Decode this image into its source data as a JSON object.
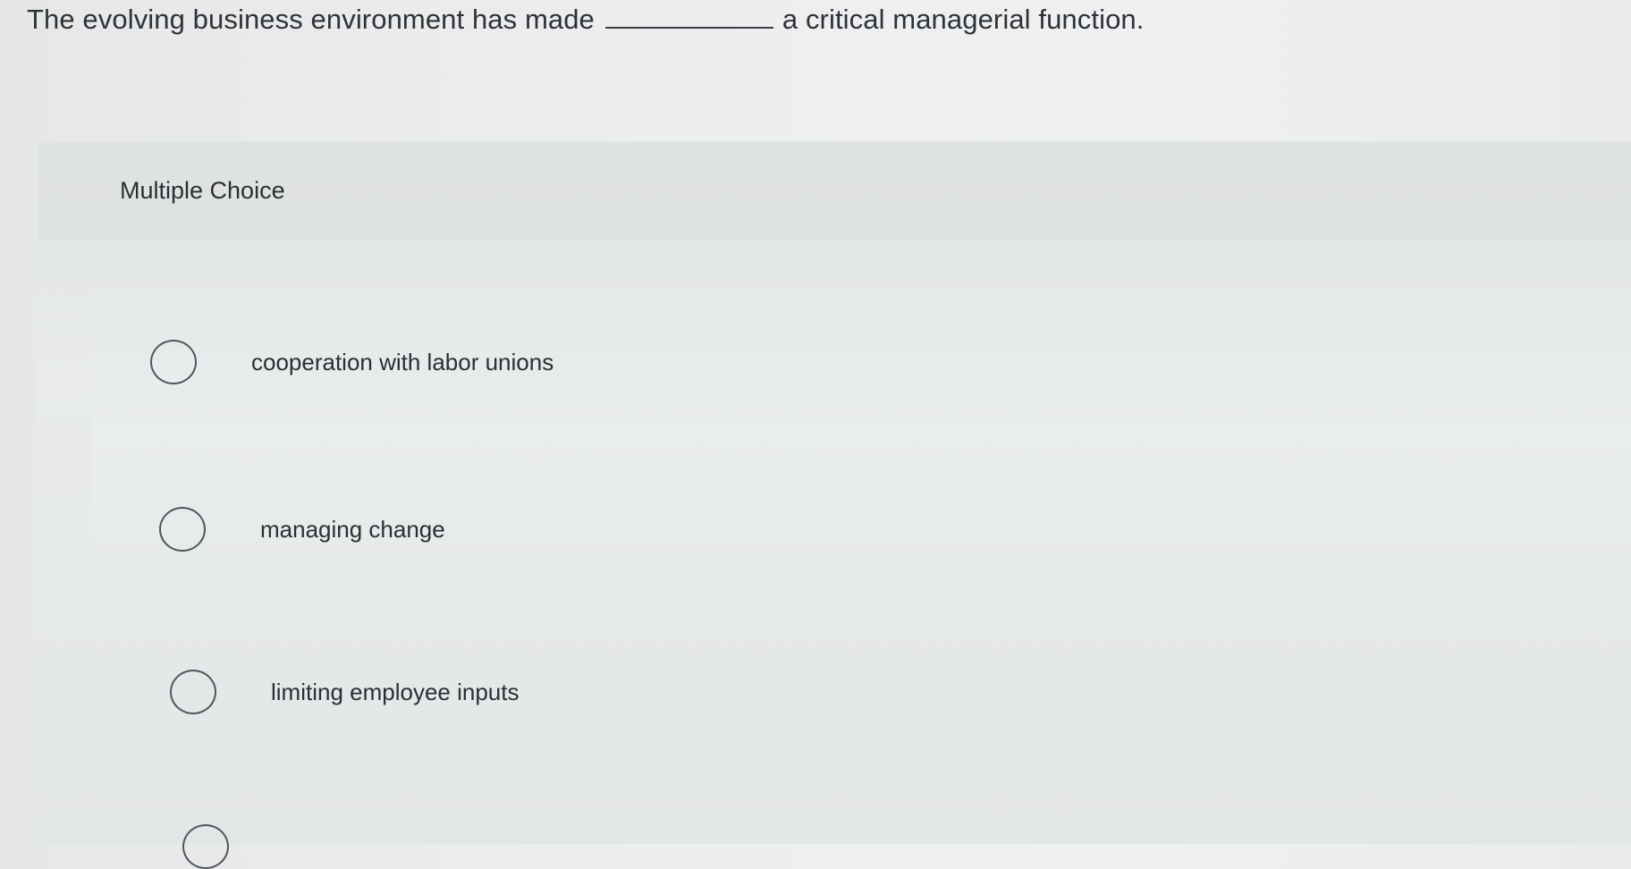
{
  "question": {
    "before_blank": "The evolving business environment has made",
    "after_blank": "a critical managerial function."
  },
  "panel": {
    "label": "Multiple Choice"
  },
  "options": [
    {
      "text": "cooperation with labor unions",
      "selected": false
    },
    {
      "text": "managing change",
      "selected": false
    },
    {
      "text": "limiting employee inputs",
      "selected": false
    },
    {
      "text": "",
      "selected": false
    }
  ],
  "colors": {
    "text": "#2f3236",
    "radio_border": "#52565c",
    "panel_bg": "#e0e3e3",
    "page_bg": "#eceeef"
  }
}
